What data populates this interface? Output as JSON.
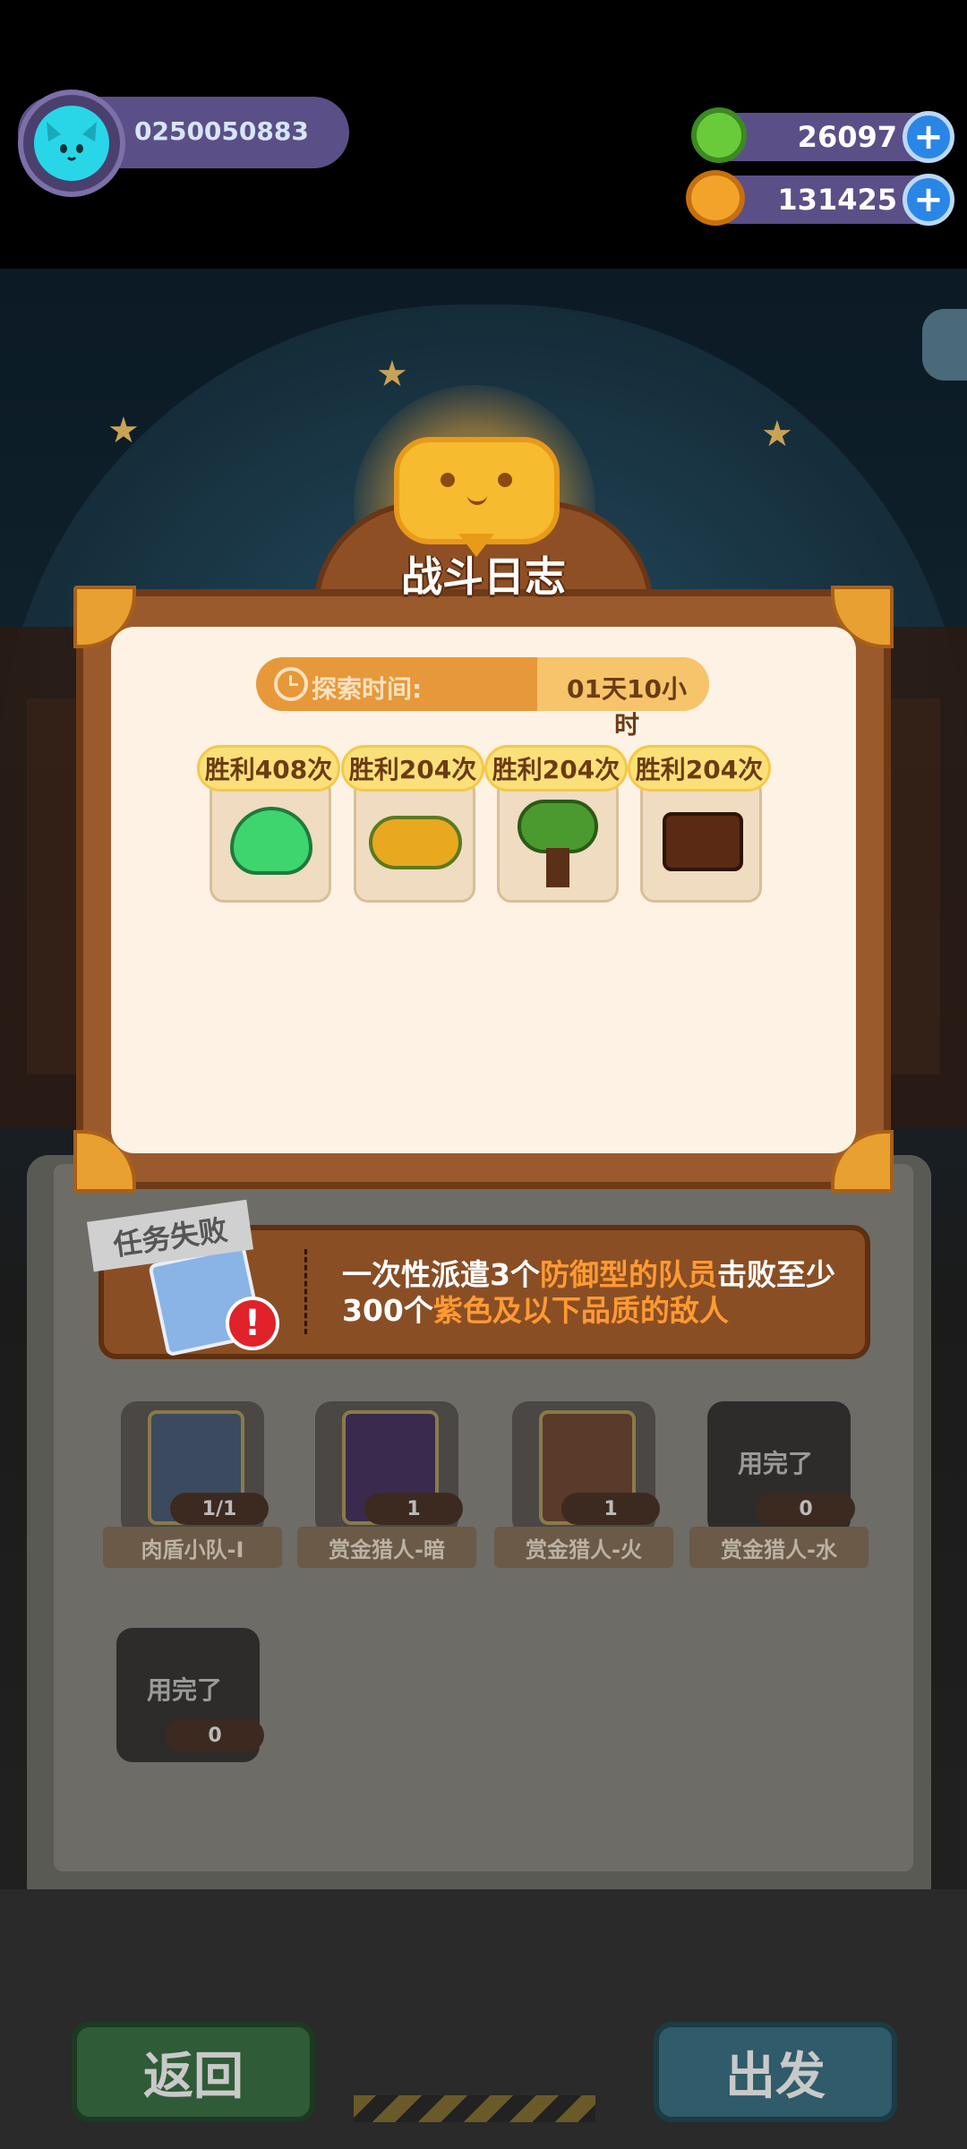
{
  "player": {
    "id": "0250050883",
    "avatar": "cat-face-icon"
  },
  "resources": {
    "gems": "26097",
    "coins": "131425"
  },
  "dialog": {
    "title": "战斗日志",
    "explore_label": "探索时间:",
    "explore_time": "01天10小时",
    "enemies": [
      {
        "wins": "胜利408次",
        "icon": "green-slime-icon"
      },
      {
        "wins": "胜利204次",
        "icon": "golden-bush-icon"
      },
      {
        "wins": "胜利204次",
        "icon": "tree-icon"
      },
      {
        "wins": "胜利204次",
        "icon": "stump-monster-icon"
      }
    ]
  },
  "mission": {
    "status": "任务失败",
    "text_a": "一次性派遣3个",
    "text_b": "防御型的队员",
    "text_c": "击败至少300个",
    "text_d": "紫色及以下品质的敌人"
  },
  "slots": [
    {
      "label": "肉盾小队-I",
      "count": "1/1"
    },
    {
      "label": "赏金猎人-暗",
      "count": "1"
    },
    {
      "label": "赏金猎人-火",
      "count": "1"
    },
    {
      "label": "赏金猎人-水",
      "count": "0",
      "used": "用完了"
    },
    {
      "label": "",
      "count": "0",
      "used": "用完了"
    }
  ],
  "buttons": {
    "back": "返回",
    "go": "出发"
  }
}
